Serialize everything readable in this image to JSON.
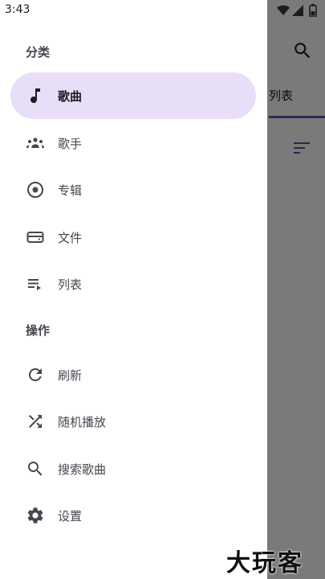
{
  "status_bar": {
    "time": "3:43"
  },
  "background": {
    "visible_tab_label": "列表"
  },
  "drawer": {
    "sections": {
      "categories_title": "分类",
      "actions_title": "操作"
    },
    "categories": [
      {
        "label": "歌曲",
        "icon": "music-note-icon",
        "selected": true
      },
      {
        "label": "歌手",
        "icon": "people-icon",
        "selected": false
      },
      {
        "label": "专辑",
        "icon": "album-icon",
        "selected": false
      },
      {
        "label": "文件",
        "icon": "folder-icon",
        "selected": false
      },
      {
        "label": "列表",
        "icon": "playlist-icon",
        "selected": false
      }
    ],
    "actions": [
      {
        "label": "刷新",
        "icon": "refresh-icon"
      },
      {
        "label": "随机播放",
        "icon": "shuffle-icon"
      },
      {
        "label": "搜索歌曲",
        "icon": "search-icon"
      },
      {
        "label": "设置",
        "icon": "gear-icon"
      }
    ]
  },
  "watermark": "大玩客",
  "colors": {
    "selected_bg": "#e8def8",
    "accent": "#6750a4",
    "icon": "#1d1b20",
    "scrim": "#000000"
  }
}
